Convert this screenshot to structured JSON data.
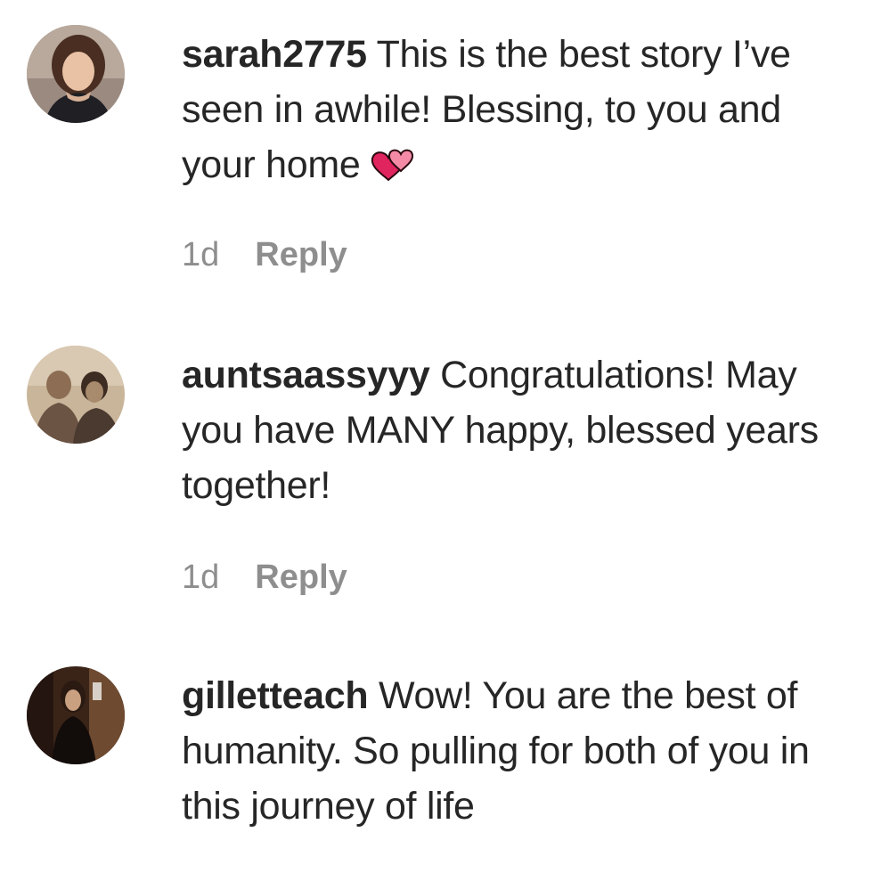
{
  "comments": [
    {
      "username": "sarah2775",
      "text": " This is the best story I’ve seen in awhile! Blessing, to you and your home",
      "emoji": "two-hearts-icon",
      "time": "1d",
      "reply_label": "Reply"
    },
    {
      "username": "auntsaassyyy",
      "text": " Congratulations! May you have MANY happy, blessed years together!",
      "time": "1d",
      "reply_label": "Reply"
    },
    {
      "username": "gilletteach",
      "text": " Wow! You are the best of humanity. So pulling for both of you in this journey of life"
    }
  ],
  "colors": {
    "text": "#262626",
    "meta": "#8e8e8e",
    "heart": "#e0245e"
  }
}
